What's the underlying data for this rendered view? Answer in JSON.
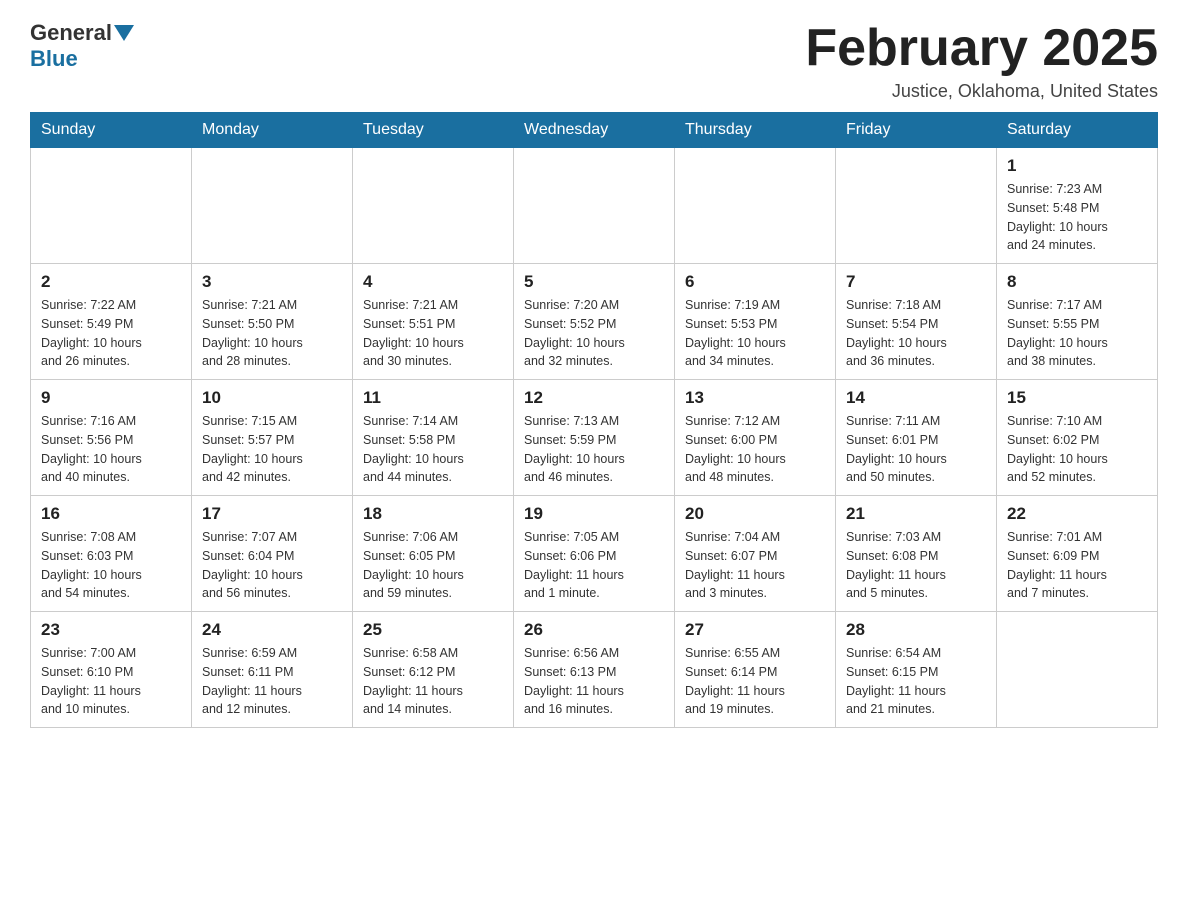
{
  "header": {
    "logo_general": "General",
    "logo_blue": "Blue",
    "month_title": "February 2025",
    "location": "Justice, Oklahoma, United States"
  },
  "weekdays": [
    "Sunday",
    "Monday",
    "Tuesday",
    "Wednesday",
    "Thursday",
    "Friday",
    "Saturday"
  ],
  "weeks": [
    [
      {
        "day": "",
        "info": ""
      },
      {
        "day": "",
        "info": ""
      },
      {
        "day": "",
        "info": ""
      },
      {
        "day": "",
        "info": ""
      },
      {
        "day": "",
        "info": ""
      },
      {
        "day": "",
        "info": ""
      },
      {
        "day": "1",
        "info": "Sunrise: 7:23 AM\nSunset: 5:48 PM\nDaylight: 10 hours\nand 24 minutes."
      }
    ],
    [
      {
        "day": "2",
        "info": "Sunrise: 7:22 AM\nSunset: 5:49 PM\nDaylight: 10 hours\nand 26 minutes."
      },
      {
        "day": "3",
        "info": "Sunrise: 7:21 AM\nSunset: 5:50 PM\nDaylight: 10 hours\nand 28 minutes."
      },
      {
        "day": "4",
        "info": "Sunrise: 7:21 AM\nSunset: 5:51 PM\nDaylight: 10 hours\nand 30 minutes."
      },
      {
        "day": "5",
        "info": "Sunrise: 7:20 AM\nSunset: 5:52 PM\nDaylight: 10 hours\nand 32 minutes."
      },
      {
        "day": "6",
        "info": "Sunrise: 7:19 AM\nSunset: 5:53 PM\nDaylight: 10 hours\nand 34 minutes."
      },
      {
        "day": "7",
        "info": "Sunrise: 7:18 AM\nSunset: 5:54 PM\nDaylight: 10 hours\nand 36 minutes."
      },
      {
        "day": "8",
        "info": "Sunrise: 7:17 AM\nSunset: 5:55 PM\nDaylight: 10 hours\nand 38 minutes."
      }
    ],
    [
      {
        "day": "9",
        "info": "Sunrise: 7:16 AM\nSunset: 5:56 PM\nDaylight: 10 hours\nand 40 minutes."
      },
      {
        "day": "10",
        "info": "Sunrise: 7:15 AM\nSunset: 5:57 PM\nDaylight: 10 hours\nand 42 minutes."
      },
      {
        "day": "11",
        "info": "Sunrise: 7:14 AM\nSunset: 5:58 PM\nDaylight: 10 hours\nand 44 minutes."
      },
      {
        "day": "12",
        "info": "Sunrise: 7:13 AM\nSunset: 5:59 PM\nDaylight: 10 hours\nand 46 minutes."
      },
      {
        "day": "13",
        "info": "Sunrise: 7:12 AM\nSunset: 6:00 PM\nDaylight: 10 hours\nand 48 minutes."
      },
      {
        "day": "14",
        "info": "Sunrise: 7:11 AM\nSunset: 6:01 PM\nDaylight: 10 hours\nand 50 minutes."
      },
      {
        "day": "15",
        "info": "Sunrise: 7:10 AM\nSunset: 6:02 PM\nDaylight: 10 hours\nand 52 minutes."
      }
    ],
    [
      {
        "day": "16",
        "info": "Sunrise: 7:08 AM\nSunset: 6:03 PM\nDaylight: 10 hours\nand 54 minutes."
      },
      {
        "day": "17",
        "info": "Sunrise: 7:07 AM\nSunset: 6:04 PM\nDaylight: 10 hours\nand 56 minutes."
      },
      {
        "day": "18",
        "info": "Sunrise: 7:06 AM\nSunset: 6:05 PM\nDaylight: 10 hours\nand 59 minutes."
      },
      {
        "day": "19",
        "info": "Sunrise: 7:05 AM\nSunset: 6:06 PM\nDaylight: 11 hours\nand 1 minute."
      },
      {
        "day": "20",
        "info": "Sunrise: 7:04 AM\nSunset: 6:07 PM\nDaylight: 11 hours\nand 3 minutes."
      },
      {
        "day": "21",
        "info": "Sunrise: 7:03 AM\nSunset: 6:08 PM\nDaylight: 11 hours\nand 5 minutes."
      },
      {
        "day": "22",
        "info": "Sunrise: 7:01 AM\nSunset: 6:09 PM\nDaylight: 11 hours\nand 7 minutes."
      }
    ],
    [
      {
        "day": "23",
        "info": "Sunrise: 7:00 AM\nSunset: 6:10 PM\nDaylight: 11 hours\nand 10 minutes."
      },
      {
        "day": "24",
        "info": "Sunrise: 6:59 AM\nSunset: 6:11 PM\nDaylight: 11 hours\nand 12 minutes."
      },
      {
        "day": "25",
        "info": "Sunrise: 6:58 AM\nSunset: 6:12 PM\nDaylight: 11 hours\nand 14 minutes."
      },
      {
        "day": "26",
        "info": "Sunrise: 6:56 AM\nSunset: 6:13 PM\nDaylight: 11 hours\nand 16 minutes."
      },
      {
        "day": "27",
        "info": "Sunrise: 6:55 AM\nSunset: 6:14 PM\nDaylight: 11 hours\nand 19 minutes."
      },
      {
        "day": "28",
        "info": "Sunrise: 6:54 AM\nSunset: 6:15 PM\nDaylight: 11 hours\nand 21 minutes."
      },
      {
        "day": "",
        "info": ""
      }
    ]
  ]
}
